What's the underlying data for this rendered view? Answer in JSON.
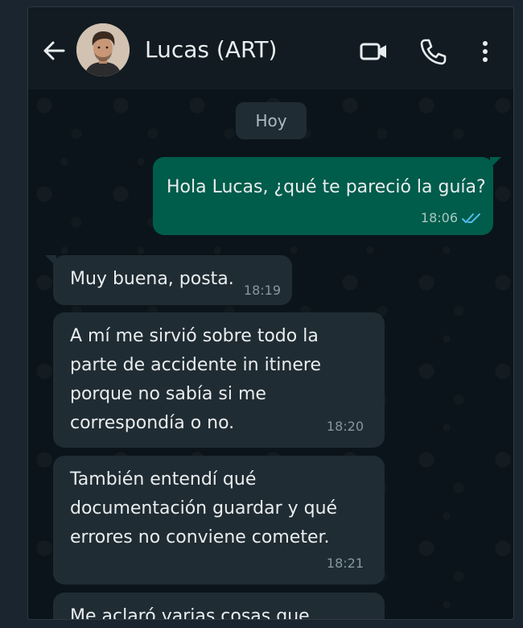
{
  "header": {
    "contact_name": "Lucas (ART)",
    "back_icon": "arrow-left-icon",
    "video_icon": "video-camera-icon",
    "call_icon": "phone-icon",
    "more_icon": "more-vertical-icon"
  },
  "chat": {
    "day_label": "Hoy",
    "messages": [
      {
        "direction": "outgoing",
        "text": "Hola Lucas, ¿qué te pareció la guía?",
        "time": "18:06",
        "status": "read"
      },
      {
        "direction": "incoming",
        "text": "Muy buena, posta.",
        "time": "18:19"
      },
      {
        "direction": "incoming",
        "text": "A mí me sirvió sobre todo la\nparte de accidente in itinere\nporque no sabía si me\ncorrespondía o no.",
        "time": "18:20"
      },
      {
        "direction": "incoming",
        "text": "También entendí qué\ndocumentación guardar y qué\nerrores no conviene cometer.",
        "time": "18:21"
      },
      {
        "direction": "incoming",
        "text": "Me aclaró varias cosas que",
        "time": ""
      }
    ]
  },
  "colors": {
    "background": "#0b141a",
    "header": "#111b21",
    "outgoing_bubble": "#005c4b",
    "incoming_bubble": "#202c33",
    "read_ticks": "#53bdeb"
  }
}
